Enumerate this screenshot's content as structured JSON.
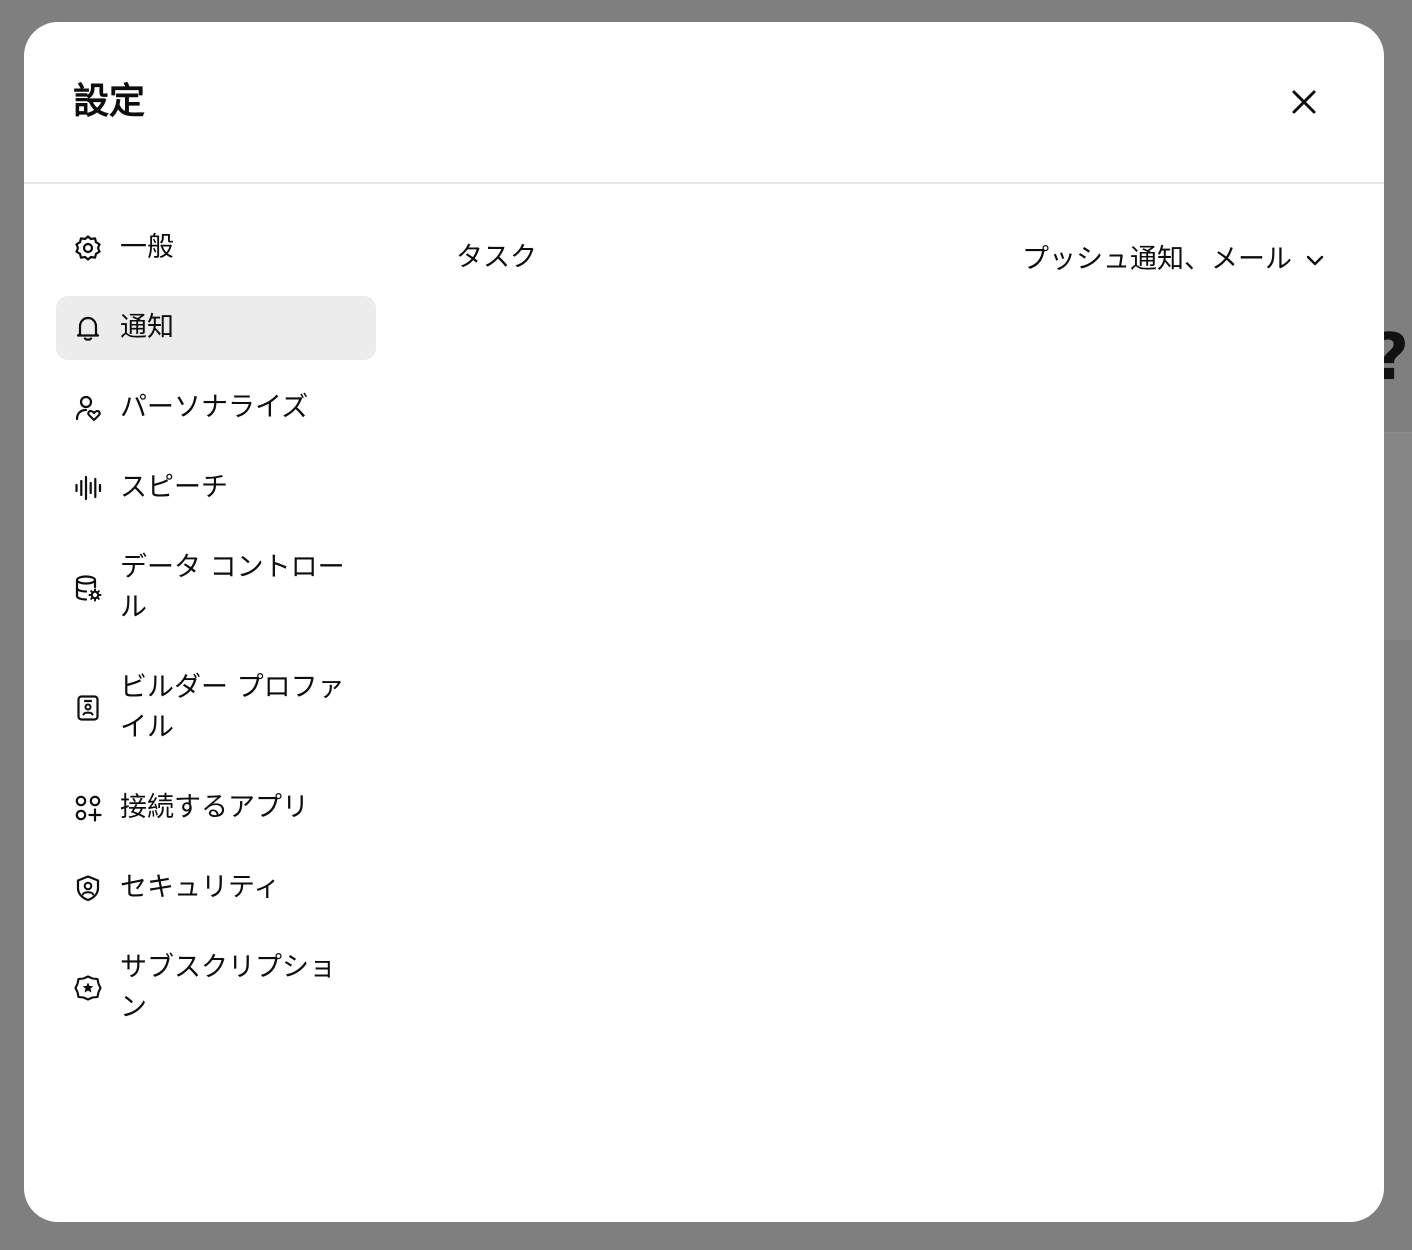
{
  "dialog": {
    "title": "設定",
    "close_label": "close"
  },
  "sidebar": {
    "items": [
      {
        "label": "一般",
        "icon": "gear-icon",
        "active": false
      },
      {
        "label": "通知",
        "icon": "bell-icon",
        "active": true
      },
      {
        "label": "パーソナライズ",
        "icon": "user-heart-icon",
        "active": false
      },
      {
        "label": "スピーチ",
        "icon": "waveform-icon",
        "active": false
      },
      {
        "label": "データ コントロール",
        "icon": "database-gear-icon",
        "active": false
      },
      {
        "label": "ビルダー プロファイル",
        "icon": "id-badge-icon",
        "active": false
      },
      {
        "label": "接続するアプリ",
        "icon": "apps-plus-icon",
        "active": false
      },
      {
        "label": "セキュリティ",
        "icon": "shield-user-icon",
        "active": false
      },
      {
        "label": "サブスクリプション",
        "icon": "star-badge-icon",
        "active": false
      }
    ]
  },
  "notifications": {
    "rows": [
      {
        "label": "タスク",
        "value": "プッシュ通知、メール"
      }
    ]
  },
  "background": {
    "glyph": "?"
  },
  "colors": {
    "backdrop": "#7f7f7f",
    "dialog": "#ffffff",
    "active_item": "#ececec",
    "divider": "#e5e5e5",
    "text": "#0d0d0d"
  }
}
